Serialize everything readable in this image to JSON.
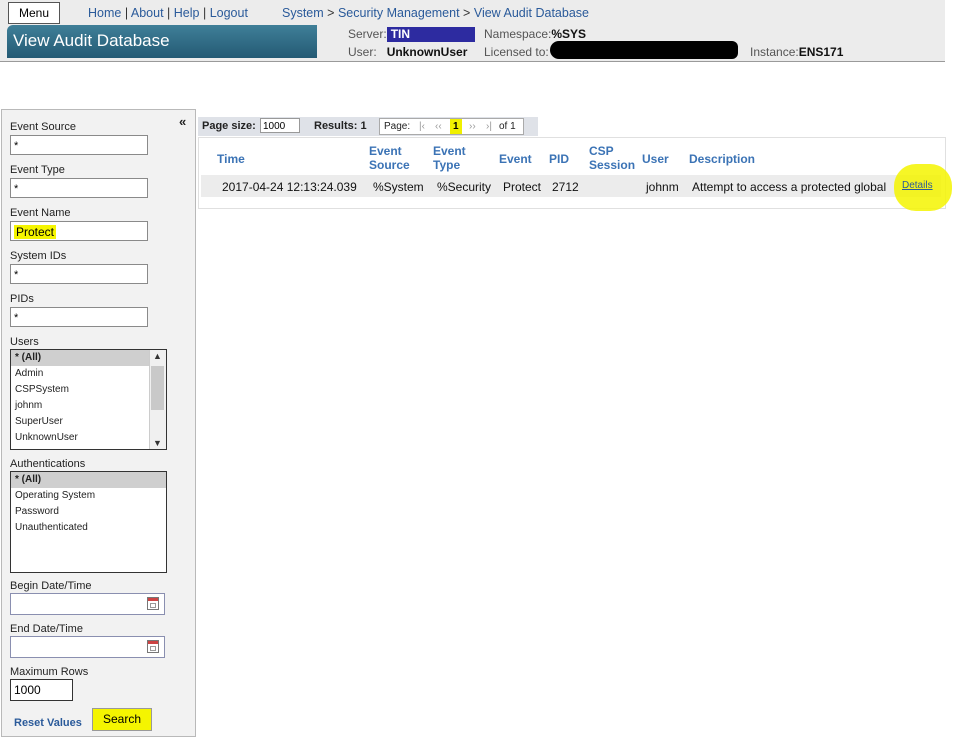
{
  "header": {
    "menu_label": "Menu",
    "links": [
      "Home",
      "About",
      "Help",
      "Logout"
    ],
    "separator": "|",
    "breadcrumb": [
      "System",
      "Security Management",
      "View Audit Database"
    ],
    "breadcrumb_sep": ">",
    "page_title": "View Audit Database",
    "server_label": "Server:",
    "server_value": "TIN",
    "user_label": "User:",
    "user_value": "UnknownUser",
    "namespace_label": "Namespace:",
    "namespace_value": "%SYS",
    "licensed_label": "Licensed to:",
    "instance_label": "Instance:",
    "instance_value": "ENS171"
  },
  "filters": {
    "collapse_icon": "«",
    "event_source_label": "Event Source",
    "event_source_value": "*",
    "event_type_label": "Event Type",
    "event_type_value": "*",
    "event_name_label": "Event Name",
    "event_name_value": "Protect",
    "system_ids_label": "System IDs",
    "system_ids_value": "*",
    "pids_label": "PIDs",
    "pids_value": "*",
    "users_label": "Users",
    "users": [
      "* (All)",
      "Admin",
      "CSPSystem",
      "johnm",
      "SuperUser",
      "UnknownUser"
    ],
    "authentications_label": "Authentications",
    "authentications": [
      "* (All)",
      "Operating System",
      "Password",
      "Unauthenticated"
    ],
    "begin_date_label": "Begin Date/Time",
    "begin_date_value": "",
    "end_date_label": "End Date/Time",
    "end_date_value": "",
    "max_rows_label": "Maximum Rows",
    "max_rows_value": "1000",
    "reset_label": "Reset Values",
    "search_label": "Search"
  },
  "results": {
    "page_size_label": "Page size:",
    "page_size_value": "1000",
    "results_label": "Results: 1",
    "page_label": "Page:",
    "first_icon": "|‹",
    "prev_icon": "‹‹",
    "current_page": "1",
    "next_icon": "››",
    "last_icon": "›|",
    "of_label": "of 1",
    "columns": [
      [
        "Time"
      ],
      [
        "Event",
        "Source"
      ],
      [
        "Event",
        "Type"
      ],
      [
        "Event"
      ],
      [
        "PID"
      ],
      [
        "CSP",
        "Session"
      ],
      [
        "User"
      ],
      [
        "Description"
      ]
    ],
    "rows": [
      {
        "time": "2017-04-24 12:13:24.039",
        "event_source": "%System",
        "event_type": "%Security",
        "event": "Protect",
        "pid": "2712",
        "csp_session": "",
        "user": "johnm",
        "description": "Attempt to access a protected global",
        "details_label": "Details"
      }
    ]
  },
  "colors": {
    "highlight": "#f5f500",
    "link": "#2a5a9a",
    "column_header": "#3b73b5",
    "title_bar": "#2f6b86",
    "server_pill": "#2d2ba0"
  }
}
